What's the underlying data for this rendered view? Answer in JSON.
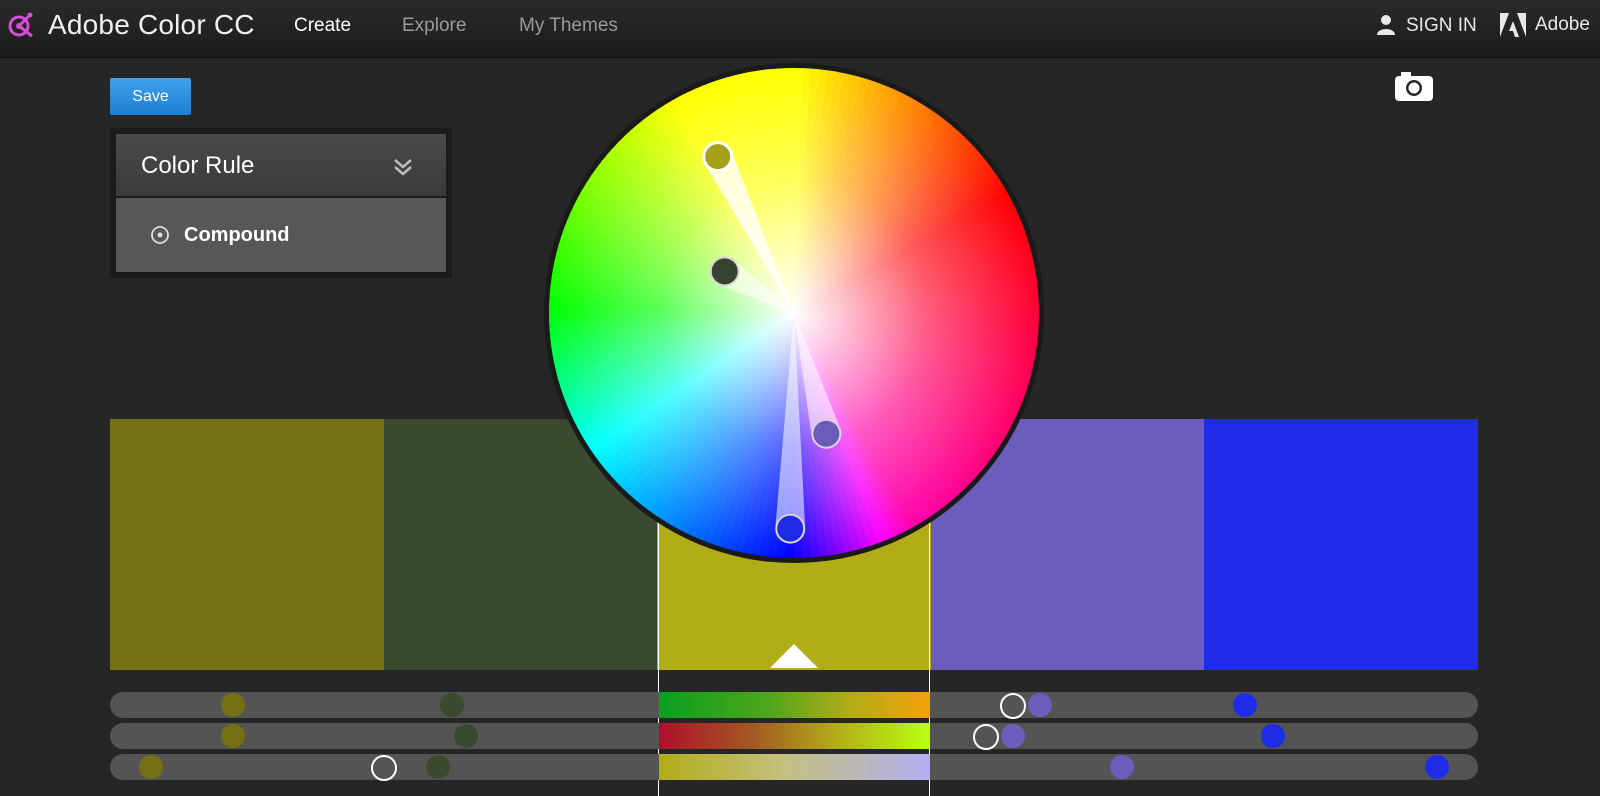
{
  "header": {
    "app_title": "Adobe Color CC",
    "nav": [
      "Create",
      "Explore",
      "My Themes"
    ],
    "active_nav": "Create",
    "sign_in": "SIGN IN",
    "adobe_label": "Adobe",
    "icons": [
      "adobe-color-logo-icon",
      "user-icon",
      "adobe-logo-icon"
    ]
  },
  "toolbar": {
    "save_label": "Save",
    "camera_icon": "camera-icon"
  },
  "color_rule": {
    "title": "Color Rule",
    "selected_option": "Compound",
    "icons": [
      "double-chevron-down-icon",
      "radio-selected-icon"
    ]
  },
  "theme": {
    "colors": [
      "#737112",
      "#3a4a2f",
      "#b2ac17",
      "#6c5cbc",
      "#1e2ce8"
    ],
    "selected_index": 2
  },
  "sliders": {
    "values": [
      [
        0.09,
        0.25,
        0.66,
        0.68,
        0.83
      ],
      [
        0.09,
        0.26,
        0.64,
        0.66,
        0.85
      ],
      [
        0.03,
        0.24,
        0.2,
        0.74,
        0.97
      ]
    ]
  },
  "wheel": {
    "markers": [
      {
        "angle": -26,
        "radius": 0.71,
        "color": "#a6a01a",
        "base": true
      },
      {
        "angle": -59,
        "radius": 0.33,
        "color": "#374231"
      },
      {
        "angle": 165,
        "radius": 0.51,
        "color": "#6a5cba"
      },
      {
        "angle": 181,
        "radius": 0.88,
        "color": "#1f2ae5"
      }
    ]
  }
}
